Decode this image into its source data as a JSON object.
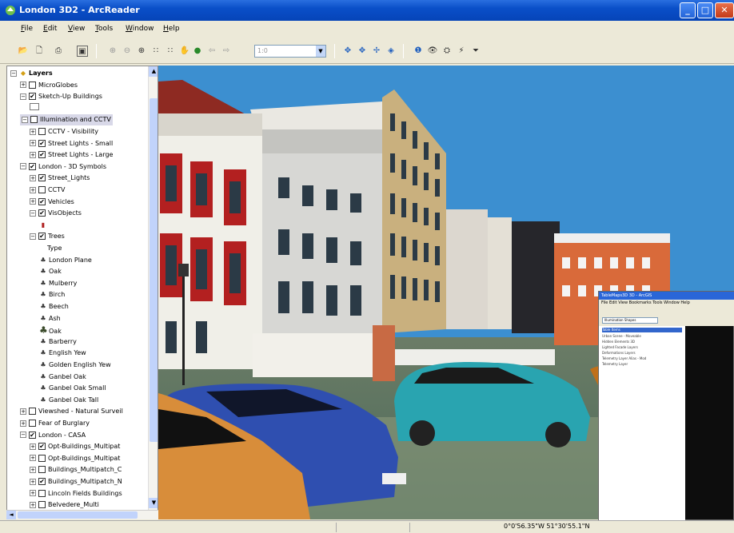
{
  "window": {
    "title": "London 3D2 - ArcReader"
  },
  "menu": [
    "File",
    "Edit",
    "View",
    "Tools",
    "Window",
    "Help"
  ],
  "toolbar": {
    "scale_value": "1:0"
  },
  "toc": {
    "rows": [
      {
        "level": 0,
        "exp": "−",
        "cb": "",
        "sym": "layers",
        "label": "Layers",
        "bold": true
      },
      {
        "level": 1,
        "exp": "+",
        "cb": " ",
        "label": "MicroGlobes"
      },
      {
        "level": 1,
        "exp": "−",
        "cb": "✔",
        "label": "Sketch-Up Buildings"
      },
      {
        "level": 2,
        "exp": "",
        "cb": "",
        "sym": "swatch",
        "label": ""
      },
      {
        "level": 1,
        "exp": "−",
        "cb": " ",
        "label": "Illumination and CCTV",
        "highlight": true
      },
      {
        "level": 2,
        "exp": "+",
        "cb": " ",
        "label": "CCTV - Visibility"
      },
      {
        "level": 2,
        "exp": "+",
        "cb": "✔",
        "label": "Street Lights - Small"
      },
      {
        "level": 2,
        "exp": "+",
        "cb": "✔",
        "label": "Street Lights - Large"
      },
      {
        "level": 1,
        "exp": "−",
        "cb": "✔",
        "label": "London - 3D Symbols"
      },
      {
        "level": 2,
        "exp": "+",
        "cb": "✔",
        "label": "Street_Lights"
      },
      {
        "level": 2,
        "exp": "+",
        "cb": " ",
        "label": "CCTV"
      },
      {
        "level": 2,
        "exp": "+",
        "cb": "✔",
        "label": "Vehicles"
      },
      {
        "level": 2,
        "exp": "−",
        "cb": "✔",
        "label": "VisObjects"
      },
      {
        "level": 3,
        "exp": "",
        "cb": "",
        "sym": "post",
        "label": ""
      },
      {
        "level": 2,
        "exp": "−",
        "cb": "✔",
        "label": "Trees"
      },
      {
        "level": 3,
        "exp": "",
        "cb": "",
        "label": "Type",
        "indent_extra": 10
      },
      {
        "level": 3,
        "exp": "",
        "cb": "",
        "sym": "tree",
        "label": "London Plane"
      },
      {
        "level": 3,
        "exp": "",
        "cb": "",
        "sym": "tree",
        "label": "Oak"
      },
      {
        "level": 3,
        "exp": "",
        "cb": "",
        "sym": "tree",
        "label": "Mulberry"
      },
      {
        "level": 3,
        "exp": "",
        "cb": "",
        "sym": "tree",
        "label": "Birch"
      },
      {
        "level": 3,
        "exp": "",
        "cb": "",
        "sym": "tree",
        "label": "Beech"
      },
      {
        "level": 3,
        "exp": "",
        "cb": "",
        "sym": "tree",
        "label": "Ash"
      },
      {
        "level": 3,
        "exp": "",
        "cb": "",
        "sym": "tree-big",
        "label": "Oak"
      },
      {
        "level": 3,
        "exp": "",
        "cb": "",
        "sym": "tree",
        "label": "Barberry"
      },
      {
        "level": 3,
        "exp": "",
        "cb": "",
        "sym": "tree",
        "label": "English Yew"
      },
      {
        "level": 3,
        "exp": "",
        "cb": "",
        "sym": "tree",
        "label": "Golden English Yew"
      },
      {
        "level": 3,
        "exp": "",
        "cb": "",
        "sym": "tree",
        "label": "Ganbel Oak"
      },
      {
        "level": 3,
        "exp": "",
        "cb": "",
        "sym": "tree",
        "label": "Ganbel Oak Small"
      },
      {
        "level": 3,
        "exp": "",
        "cb": "",
        "sym": "tree",
        "label": "Ganbel Oak Tall"
      },
      {
        "level": 1,
        "exp": "+",
        "cb": " ",
        "label": "Viewshed - Natural Surveil"
      },
      {
        "level": 1,
        "exp": "+",
        "cb": " ",
        "label": "Fear of Burglary"
      },
      {
        "level": 1,
        "exp": "−",
        "cb": "✔",
        "label": "London - CASA"
      },
      {
        "level": 2,
        "exp": "+",
        "cb": "✔",
        "label": "Opt-Buildings_Multipat"
      },
      {
        "level": 2,
        "exp": "+",
        "cb": " ",
        "label": "Opt-Buildings_Multipat"
      },
      {
        "level": 2,
        "exp": "+",
        "cb": " ",
        "label": "Buildings_Multipatch_C"
      },
      {
        "level": 2,
        "exp": "+",
        "cb": "✔",
        "label": "Buildings_Multipatch_N"
      },
      {
        "level": 2,
        "exp": "+",
        "cb": " ",
        "label": "Lincoln Fields Buildings"
      },
      {
        "level": 2,
        "exp": "+",
        "cb": " ",
        "label": "Belvedere_Multi"
      }
    ]
  },
  "status": {
    "coordinates": "0°0'56.35\"W  51°30'55.1\"N"
  },
  "inset": {
    "title": "TableMaps3D 3D - ArcGIS",
    "menu": "File  Edit  View  Bookmarks  Tools  Window  Help",
    "combo": "Illumination Shapes",
    "rows": [
      "Table Items",
      "Urban Scene - Moveable",
      "Hidden Elements 3D",
      "Lighted Facade Layers",
      "Deformations Layers",
      "Telemetry Layer Alias - Mod",
      "Telemetry Layer"
    ]
  },
  "colors": {
    "sky": "#3c8fd0",
    "title_bar": "#0a4fc8",
    "highlight": "#d8d8e8"
  }
}
